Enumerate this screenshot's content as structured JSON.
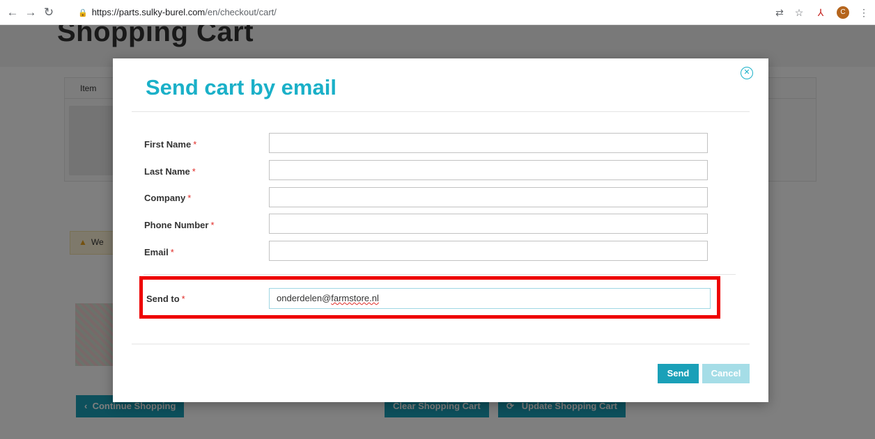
{
  "browser": {
    "url_host": "https://parts.sulky-burel.com",
    "url_path": "/en/checkout/cart/",
    "profile_initial": "C"
  },
  "page": {
    "title": "Shopping Cart",
    "table_header_item": "Item",
    "warning_text": "We",
    "continue_label": "Continue Shopping",
    "clear_label": "Clear Shopping Cart",
    "update_label": "Update Shopping Cart"
  },
  "modal": {
    "title": "Send cart by email",
    "required_mark": "*",
    "fields": [
      {
        "label": "First Name",
        "value": ""
      },
      {
        "label": "Last Name",
        "value": ""
      },
      {
        "label": "Company",
        "value": ""
      },
      {
        "label": "Phone Number",
        "value": ""
      },
      {
        "label": "Email",
        "value": ""
      }
    ],
    "send_to_label": "Send to",
    "send_to_value_prefix": "onderdelen@",
    "send_to_value_underlined": "farmstore.nl",
    "send_label": "Send",
    "cancel_label": "Cancel"
  },
  "colors": {
    "accent": "#1ab0c8",
    "button": "#1aa0b8",
    "highlight_border": "#ee0000",
    "required": "#e02b27"
  },
  "icons": {
    "back": "arrow-left-icon",
    "forward": "arrow-right-icon",
    "reload": "reload-icon",
    "lock": "lock-icon",
    "close": "close-icon",
    "warning": "warning-icon"
  }
}
